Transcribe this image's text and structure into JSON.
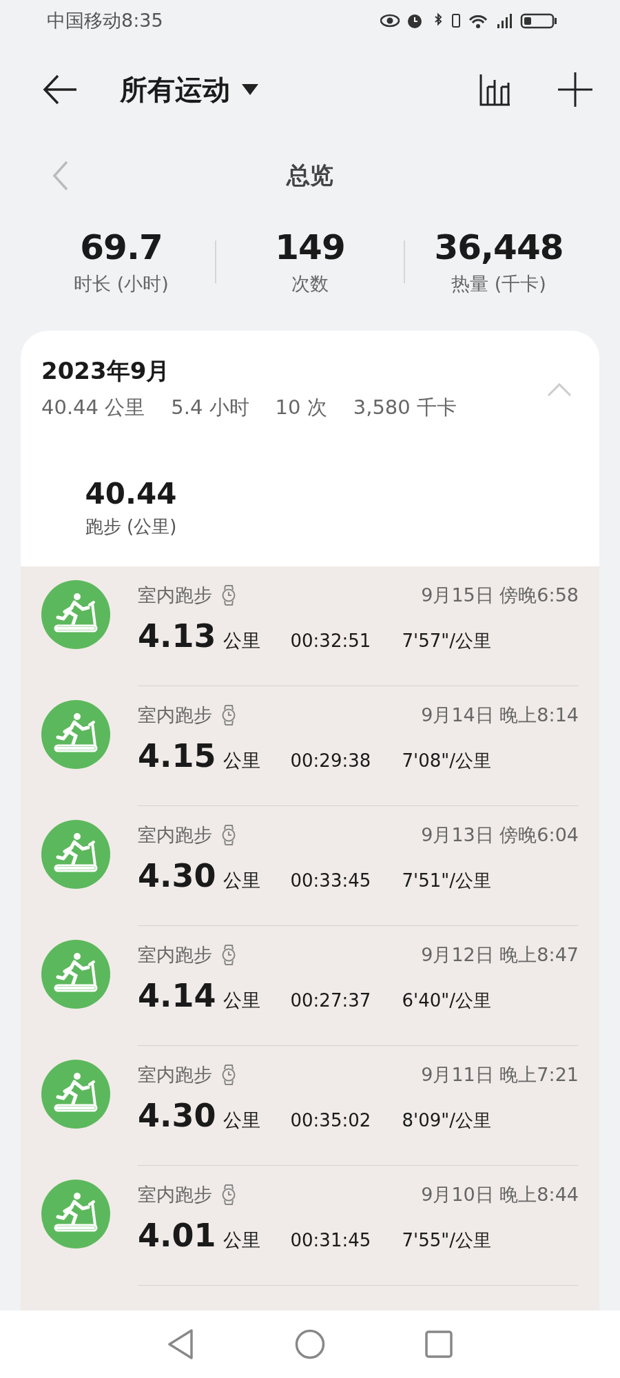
{
  "status_bar": {
    "carrier": "中国移动",
    "time": "8:35"
  },
  "header": {
    "title": "所有运动"
  },
  "overview": {
    "title": "总览",
    "stats": [
      {
        "value": "69.7",
        "label": "时长 (小时)"
      },
      {
        "value": "149",
        "label": "次数"
      },
      {
        "value": "36,448",
        "label": "热量 (千卡)"
      }
    ]
  },
  "month": {
    "title": "2023年9月",
    "expanded": true,
    "summary": [
      "40.44 公里",
      "5.4 小时",
      "10 次",
      "3,580 千卡"
    ],
    "total": {
      "value": "40.44",
      "label": "跑步 (公里)"
    },
    "rows": [
      {
        "type": "室内跑步",
        "date": "9月15日 傍晚6:58",
        "distance": "4.13",
        "unit": "公里",
        "duration": "00:32:51",
        "pace": "7'57\"/公里"
      },
      {
        "type": "室内跑步",
        "date": "9月14日 晚上8:14",
        "distance": "4.15",
        "unit": "公里",
        "duration": "00:29:38",
        "pace": "7'08\"/公里"
      },
      {
        "type": "室内跑步",
        "date": "9月13日 傍晚6:04",
        "distance": "4.30",
        "unit": "公里",
        "duration": "00:33:45",
        "pace": "7'51\"/公里"
      },
      {
        "type": "室内跑步",
        "date": "9月12日 晚上8:47",
        "distance": "4.14",
        "unit": "公里",
        "duration": "00:27:37",
        "pace": "6'40\"/公里"
      },
      {
        "type": "室内跑步",
        "date": "9月11日 晚上7:21",
        "distance": "4.30",
        "unit": "公里",
        "duration": "00:35:02",
        "pace": "8'09\"/公里"
      },
      {
        "type": "室内跑步",
        "date": "9月10日 晚上8:44",
        "distance": "4.01",
        "unit": "公里",
        "duration": "00:31:45",
        "pace": "7'55\"/公里"
      }
    ]
  }
}
